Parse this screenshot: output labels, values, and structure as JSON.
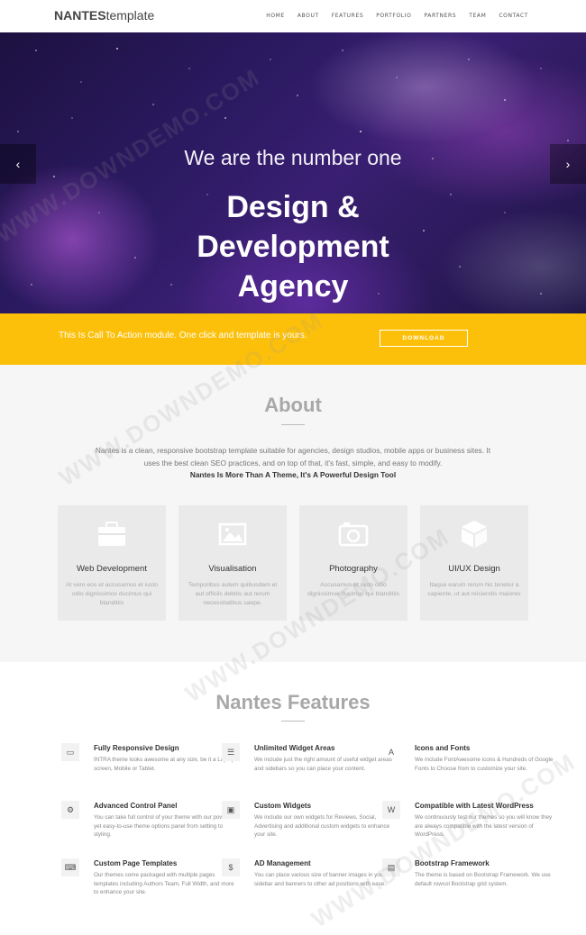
{
  "nav": {
    "brand_bold": "NANTES",
    "brand_light": "template",
    "items": [
      "HOME",
      "ABOUT",
      "FEATURES",
      "PORTFOLIO",
      "PARTNERS",
      "TEAM",
      "CONTACT"
    ]
  },
  "hero": {
    "subtitle": "We are the number one",
    "title_lines": [
      "Design &",
      "Development",
      "Agency"
    ],
    "prev_arrow": "‹",
    "next_arrow": "›"
  },
  "cta": {
    "text": "This Is Call To Action module. One click and template is yours.",
    "button": "DOWNLOAD"
  },
  "about": {
    "title": "About",
    "text": "Nantes is a clean, responsive bootstrap template suitable for agencies, design studios, mobile apps or business sites. It uses the best clean SEO practices, and on top of that, it's fast, simple, and easy to modify.",
    "bold": "Nantes Is More Than A Theme, It's A Powerful Design Tool",
    "cards": [
      {
        "icon": "briefcase-icon",
        "title": "Web Development",
        "desc": "At vero eos et accusamus et iusto odio dignissimos ducimus qui blanditiis"
      },
      {
        "icon": "image-gallery-icon",
        "title": "Visualisation",
        "desc": "Temporibus autem quibusdam et aut officiis debitis aut rerum necessitatibus saepe."
      },
      {
        "icon": "camera-icon",
        "title": "Photography",
        "desc": "Accusamus et iusto odio dignissimos ducimus qui blanditiis"
      },
      {
        "icon": "cube-icon",
        "title": "UI/UX Design",
        "desc": "Itaque earum rerum hic tenetur a sapiente, ut aut reiciendis maiores"
      }
    ]
  },
  "features": {
    "title": "Nantes Features",
    "items": [
      {
        "icon": "monitor-icon",
        "glyph": "▭",
        "title": "Fully Responsive Design",
        "desc": "INTRA theme looks awesome at any size, be it a Laptop screen, Mobile or Tablet."
      },
      {
        "icon": "list-icon",
        "glyph": "☰",
        "title": "Unlimited Widget Areas",
        "desc": "We include just the right amount of useful widget areas and sidebars so you can place your content."
      },
      {
        "icon": "font-icon",
        "glyph": "A",
        "title": "Icons and Fonts",
        "desc": "We include FontAwesome icons & Hundreds of Google Fonts to Choose from to customize your site."
      },
      {
        "icon": "cogs-icon",
        "glyph": "⚙",
        "title": "Advanced Control Panel",
        "desc": "You can take full control of your theme with our powerful yet easy-to-use theme options panel from setting to styling."
      },
      {
        "icon": "widgets-icon",
        "glyph": "▣",
        "title": "Custom Widgets",
        "desc": "We include our own widgets for Reviews, Social, Advertising and additional custom widgets to enhance your site."
      },
      {
        "icon": "wordpress-icon",
        "glyph": "W",
        "title": "Compatible with Latest WordPress",
        "desc": "We continuously test our themes so you will know they are always compatible with the latest version of WordPress."
      },
      {
        "icon": "keyboard-icon",
        "glyph": "⌨",
        "title": "Custom Page Templates",
        "desc": "Our themes come packaged with multiple pages templates including Authors Team, Full Width, and more to enhance your site."
      },
      {
        "icon": "dollar-icon",
        "glyph": "$",
        "title": "AD Management",
        "desc": "You can place various size of banner images in your sidebar and banners to other ad positions with ease."
      },
      {
        "icon": "file-icon",
        "glyph": "▤",
        "title": "Bootstrap Framework",
        "desc": "The theme is based on Bootstrap Framework. We use default rowcol Bootstrap grid system."
      }
    ]
  },
  "watermark": "WWW.DOWNDEMO.COM"
}
